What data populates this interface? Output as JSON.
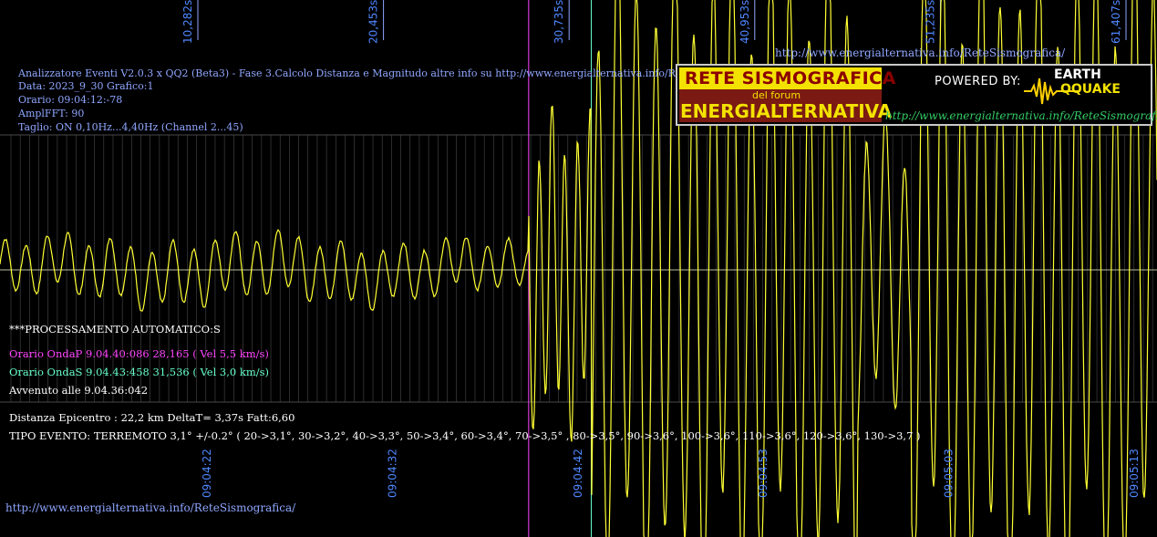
{
  "chart_data": {
    "type": "line",
    "colors": {
      "trace": "#ffff33",
      "grid_major": "#8fa6ff",
      "grid_minor": "#4a4a4a",
      "baseline": "#bdbd9a",
      "p_wave_marker": "#ff44ff",
      "s_wave_marker": "#66ffcc",
      "time_label": "#4f87ff"
    },
    "seconds_labels": [
      "10,282s",
      "20,453s",
      "30,735s",
      "40,953s",
      "51,235s",
      "61,407s"
    ],
    "time_labels": [
      "09:04:22",
      "09:04:32",
      "09:04:42",
      "09:04:53",
      "09:05:03",
      "09:05:13"
    ],
    "markers": [
      {
        "name": "OndaP",
        "time": "9.04.40:086",
        "seconds": 28.165
      },
      {
        "name": "OndaS",
        "time": "9.04.43:458",
        "seconds": 31.536
      }
    ],
    "grid": true
  },
  "header": {
    "line1": "Analizzatore Eventi V2.0.3 x QQ2 (Beta3) - Fase 3.Calcolo Distanza e Magnitudo altre info su http://www.energialternativa.info/ReteSism",
    "line2": "Data: 2023_9_30 Grafico:1",
    "line3": "Orario: 09:04:12:-78",
    "line4": "AmplFFT: 90",
    "line5": "Taglio: ON 0,10Hz...4,40Hz       (Channel 2...45)"
  },
  "top_url": "http://www.energialternativa.info/ReteSismografica/",
  "processing": {
    "title": "***PROCESSAMENTO AUTOMATICO:S",
    "onda_p": "Orario OndaP 9.04.40:086  28,165 ( Vel 5,5 km/s)",
    "onda_s": "Orario OndaS 9.04.43:458  31,536 ( Vel 3,0 km/s)",
    "avvenuto": "Avvenuto alle 9.04.36:042",
    "distanza": "Distanza Epicentro : 22,2 km DeltaT= 3,37s  Fatt:6,60",
    "tipo": "TIPO EVENTO: TERREMOTO 3,1° +/-0.2° ( 20->3,1°, 30->3,2°, 40->3,3°, 50->3,4°, 60->3,4°, 70->3,5° , 80->3,5°, 90->3,6°, 100->3,6°, 110->3,6°, 120->3,6°, 130->3,7 )"
  },
  "footer_url": "http://www.energialternativa.info/ReteSismografica/",
  "logo": {
    "line1": "RETE SISMOGRAFICA",
    "line2": "del forum",
    "line3": "ENERGIALTERNATIVA",
    "powered": "POWERED BY:",
    "brand_top": "EARTH",
    "brand_bottom": "QQUAKE",
    "url": "http://www.energialternativa.info/ReteSismografica"
  }
}
